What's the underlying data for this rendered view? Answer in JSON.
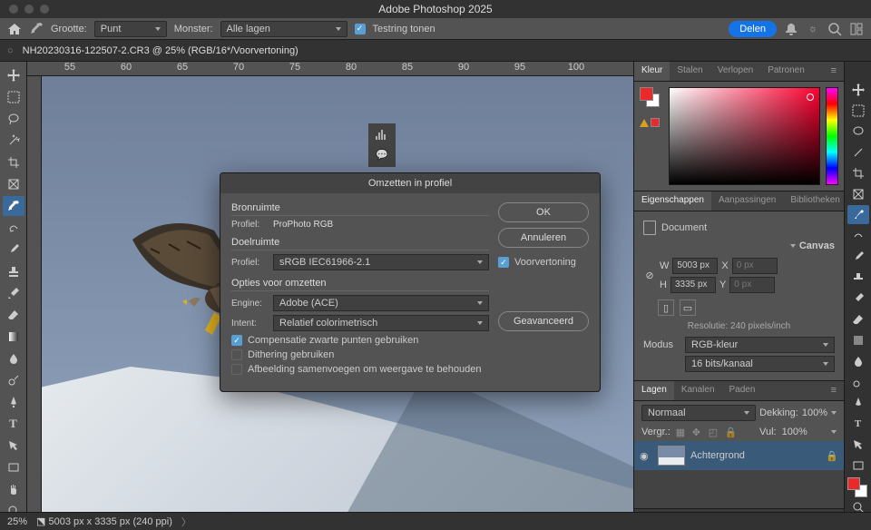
{
  "app": {
    "title": "Adobe Photoshop 2025"
  },
  "options": {
    "size_label": "Grootte:",
    "size_value": "Punt",
    "sample_label": "Monster:",
    "sample_value": "Alle lagen",
    "testring": "Testring tonen",
    "share": "Delen"
  },
  "document": {
    "tab": "NH20230316-122507-2.CR3 @ 25% (RGB/16*/Voorvertoning)",
    "zoom": "25%",
    "status": "5003 px x 3335 px (240 ppi)"
  },
  "ruler": [
    "55",
    "60",
    "65",
    "70",
    "75",
    "80",
    "85",
    "90",
    "95",
    "100"
  ],
  "color_panel": {
    "tabs": [
      "Kleur",
      "Stalen",
      "Verlopen",
      "Patronen"
    ]
  },
  "properties": {
    "tabs": [
      "Eigenschappen",
      "Aanpassingen",
      "Bibliotheken"
    ],
    "doc_label": "Document",
    "canvas_label": "Canvas",
    "W": "W",
    "W_val": "5003 px",
    "X": "X",
    "X_val": "0 px",
    "H": "H",
    "H_val": "3335 px",
    "Y": "Y",
    "Y_val": "0 px",
    "resolution": "Resolutie: 240 pixels/inch",
    "mode_label": "Modus",
    "mode_val": "RGB-kleur",
    "depth_val": "16 bits/kanaal"
  },
  "layers": {
    "tabs": [
      "Lagen",
      "Kanalen",
      "Paden"
    ],
    "blend": "Normaal",
    "opacity_label": "Dekking:",
    "opacity_val": "100%",
    "lock_label": "Vergr.:",
    "fill_label": "Vul:",
    "fill_val": "100%",
    "layer_name": "Achtergrond"
  },
  "dialog": {
    "title": "Omzetten in profiel",
    "source_section": "Bronruimte",
    "profile_label": "Profiel:",
    "source_profile": "ProPhoto RGB",
    "dest_section": "Doelruimte",
    "dest_profile": "sRGB IEC61966-2.1",
    "options_section": "Opties voor omzetten",
    "engine_label": "Engine:",
    "engine_val": "Adobe (ACE)",
    "intent_label": "Intent:",
    "intent_val": "Relatief colorimetrisch",
    "bpc": "Compensatie zwarte punten gebruiken",
    "dither": "Dithering gebruiken",
    "flatten": "Afbeelding samenvoegen om weergave te behouden",
    "ok": "OK",
    "cancel": "Annuleren",
    "preview": "Voorvertoning",
    "advanced": "Geavanceerd"
  }
}
